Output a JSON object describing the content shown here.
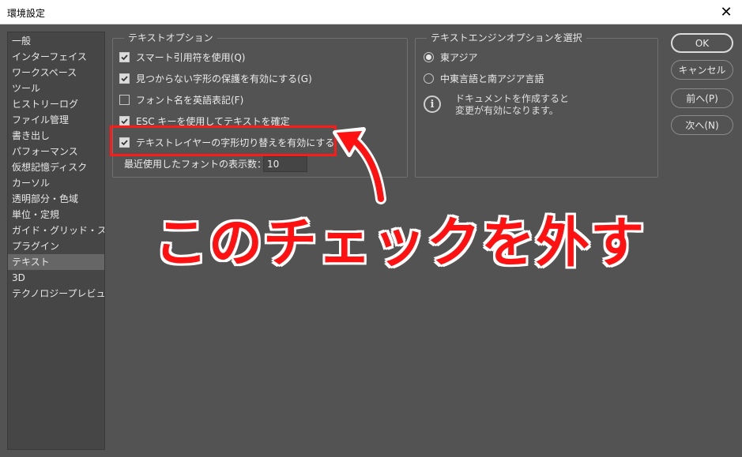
{
  "window": {
    "title": "環境設定",
    "close_glyph": "✕"
  },
  "sidebar": {
    "items": [
      {
        "label": "一般"
      },
      {
        "label": "インターフェイス"
      },
      {
        "label": "ワークスペース"
      },
      {
        "label": "ツール"
      },
      {
        "label": "ヒストリーログ"
      },
      {
        "label": "ファイル管理"
      },
      {
        "label": "書き出し"
      },
      {
        "label": "パフォーマンス"
      },
      {
        "label": "仮想記憶ディスク"
      },
      {
        "label": "カーソル"
      },
      {
        "label": "透明部分・色域"
      },
      {
        "label": "単位・定規"
      },
      {
        "label": "ガイド・グリッド・スライス"
      },
      {
        "label": "プラグイン"
      },
      {
        "label": "テキスト",
        "selected": true
      },
      {
        "label": "3D"
      },
      {
        "label": "テクノロジープレビュー"
      }
    ]
  },
  "text_options": {
    "group_title": "テキストオプション",
    "options": [
      {
        "label": "スマート引用符を使用(Q)",
        "checked": true
      },
      {
        "label": "見つからない字形の保護を有効にする(G)",
        "checked": true
      },
      {
        "label": "フォント名を英語表記(F)",
        "checked": false
      },
      {
        "label": "ESC キーを使用してテキストを確定",
        "checked": true
      },
      {
        "label": "テキストレイヤーの字形切り替えを有効にする",
        "checked": true
      }
    ],
    "recent_fonts_label": "最近使用したフォントの表示数：",
    "recent_fonts_value": "10"
  },
  "engine_options": {
    "group_title": "テキストエンジンオプションを選択",
    "radios": [
      {
        "label": "東アジア",
        "selected": true
      },
      {
        "label": "中東言語と南アジア言語",
        "selected": false
      }
    ],
    "info_glyph": "i",
    "info_line1": "ドキュメントを作成すると",
    "info_line2": "変更が有効になります。"
  },
  "buttons": {
    "ok": "OK",
    "cancel": "キャンセル",
    "prev": "前へ(P)",
    "next": "次へ(N)"
  },
  "annotation": {
    "text": "このチェックを外す",
    "color": "#ff1111"
  }
}
